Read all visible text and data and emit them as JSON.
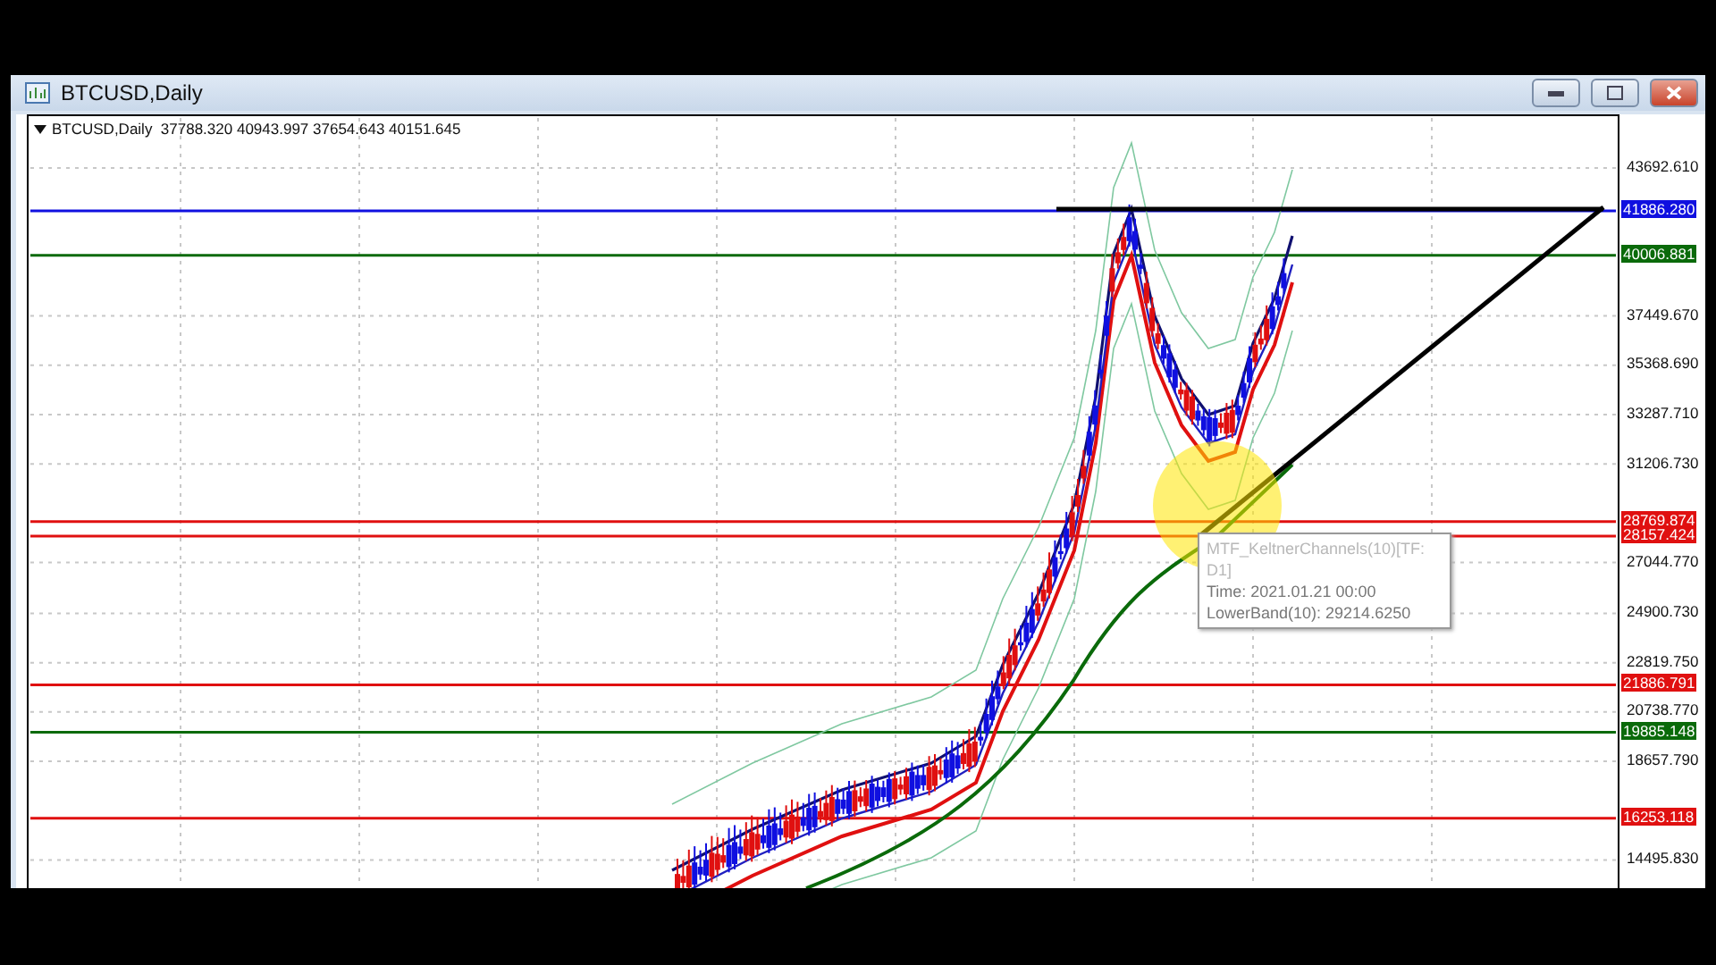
{
  "window": {
    "title": "BTCUSD,Daily"
  },
  "chart": {
    "header": "BTCUSD,Daily  37788.320 40943.997 37654.643 40151.645",
    "price_ticks": [
      "43692.610",
      "37449.670",
      "35368.690",
      "33287.710",
      "31206.730",
      "27044.770",
      "24900.730",
      "22819.750",
      "20738.770",
      "18657.790",
      "14495.830"
    ],
    "levels": [
      {
        "price": "41886.280",
        "color": "#1010e0"
      },
      {
        "price": "40006.881",
        "color": "#0a6a0a"
      },
      {
        "price": "28769.874",
        "color": "#e01010"
      },
      {
        "price": "28157.424",
        "color": "#e01010"
      },
      {
        "price": "21886.791",
        "color": "#e01010"
      },
      {
        "price": "19885.148",
        "color": "#0a6a0a"
      },
      {
        "price": "16253.118",
        "color": "#e01010"
      }
    ],
    "tooltip": {
      "title": "MTF_KeltnerChannels(10)[TF: D1]",
      "time": "Time: 2021.01.21 00:00",
      "value": "LowerBand(10): 29214.6250"
    }
  }
}
